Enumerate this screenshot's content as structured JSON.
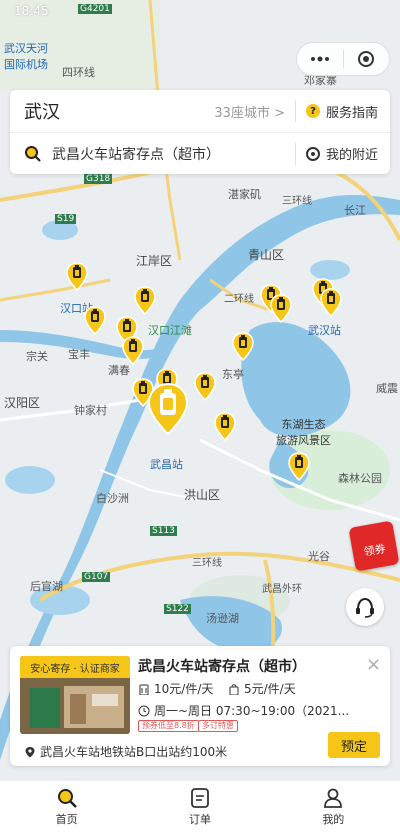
{
  "status": {
    "time": "18:45"
  },
  "map": {
    "labels": {
      "airport": "武汉天河\n国际机场",
      "road_g4201": "G4201",
      "sihuan": "四环线",
      "dengjiazhai": "邓家寨",
      "s19": "S19",
      "g318": "G318",
      "zhanjiaji": "湛家矶",
      "sanhuan_top": "三环线",
      "changjiang": "长江",
      "jiangan": "江岸区",
      "qingshan": "青山区",
      "hankou_station": "汉口站",
      "hankou_jiangtan": "汉口江滩",
      "erhuan": "二环线",
      "wuhan_station": "武汉站",
      "zongguan": "宗关",
      "baofeng": "宝丰",
      "manchun": "满春",
      "donglu": "东亭",
      "hanyang": "汉阳区",
      "zhongjiacun": "钟家村",
      "weiyuan": "威震",
      "donghu": "东湖生态\n旅游风景区",
      "wuchang_station": "武昌站",
      "senlin": "森林公园",
      "baishazhou": "白沙洲",
      "hongshan": "洪山区",
      "s113": "S113",
      "guanggu": "光谷",
      "sanhuan_bottom": "三环线",
      "houguanhu": "后官湖",
      "g107": "G107",
      "s122": "S122",
      "tangxunhu": "汤逊湖",
      "wuchang_ring": "武昌外环"
    }
  },
  "search": {
    "city": "武汉",
    "city_count": "33座城市 >",
    "guide": "服务指南",
    "store_query": "武昌火车站寄存点（超市）",
    "nearby": "我的附近"
  },
  "coupon": {
    "label": "领券"
  },
  "store": {
    "badge": "安心寄存 · 认证商家",
    "name": "武昌火车站寄存点（超市）",
    "price_large": "10元/件/天",
    "price_small": "5元/件/天",
    "hours": "周一~周日 07:30~19:00（2021...",
    "tags": [
      "预券低至8.8折",
      "多订特惠"
    ],
    "address": "武昌火车站地铁站B口出站约100米",
    "book": "预定"
  },
  "tabs": [
    {
      "label": "首页",
      "icon": "search-icon"
    },
    {
      "label": "订单",
      "icon": "order-icon"
    },
    {
      "label": "我的",
      "icon": "user-icon"
    }
  ],
  "colors": {
    "accent": "#f5c518",
    "water": "#8fc6e8",
    "land": "#eaeef0"
  }
}
